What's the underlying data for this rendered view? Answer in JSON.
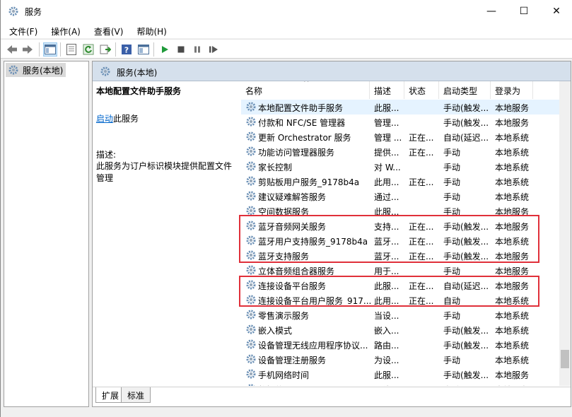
{
  "window": {
    "title": "服务",
    "minimize": "—",
    "maximize": "☐",
    "close": "✕"
  },
  "menu": [
    "文件(F)",
    "操作(A)",
    "查看(V)",
    "帮助(H)"
  ],
  "tree": {
    "item": "服务(本地)"
  },
  "pane": {
    "header": "服务(本地)",
    "selected_title": "本地配置文件助手服务",
    "start_link": "启动",
    "start_suffix": "此服务",
    "desc_label": "描述:",
    "desc_text": "此服务为订户标识模块提供配置文件管理"
  },
  "columns": [
    "名称",
    "描述",
    "状态",
    "启动类型",
    "登录为"
  ],
  "services": [
    {
      "name": "本地配置文件助手服务",
      "desc": "此服...",
      "status": "",
      "start": "手动(触发...",
      "login": "本地服务"
    },
    {
      "name": "付款和 NFC/SE 管理器",
      "desc": "管理...",
      "status": "",
      "start": "手动(触发...",
      "login": "本地服务"
    },
    {
      "name": "更新 Orchestrator 服务",
      "desc": "管理 ...",
      "status": "正在...",
      "start": "自动(延迟...",
      "login": "本地系统"
    },
    {
      "name": "功能访问管理器服务",
      "desc": "提供...",
      "status": "正在...",
      "start": "手动",
      "login": "本地系统"
    },
    {
      "name": "家长控制",
      "desc": "对 W...",
      "status": "",
      "start": "手动",
      "login": "本地系统"
    },
    {
      "name": "剪贴板用户服务_9178b4a",
      "desc": "此用...",
      "status": "正在...",
      "start": "手动",
      "login": "本地系统"
    },
    {
      "name": "建议疑难解答服务",
      "desc": "通过...",
      "status": "",
      "start": "手动",
      "login": "本地系统"
    },
    {
      "name": "空间数据服务",
      "desc": "此服...",
      "status": "",
      "start": "手动",
      "login": "本地服务"
    },
    {
      "name": "蓝牙音频网关服务",
      "desc": "支持...",
      "status": "正在...",
      "start": "手动(触发...",
      "login": "本地服务"
    },
    {
      "name": "蓝牙用户支持服务_9178b4a",
      "desc": "蓝牙...",
      "status": "正在...",
      "start": "手动(触发...",
      "login": "本地系统"
    },
    {
      "name": "蓝牙支持服务",
      "desc": "蓝牙...",
      "status": "正在...",
      "start": "手动(触发...",
      "login": "本地服务"
    },
    {
      "name": "立体音频组合器服务",
      "desc": "用于...",
      "status": "",
      "start": "手动",
      "login": "本地服务"
    },
    {
      "name": "连接设备平台服务",
      "desc": "此服...",
      "status": "正在...",
      "start": "自动(延迟...",
      "login": "本地服务"
    },
    {
      "name": "连接设备平台用户服务_917...",
      "desc": "此用...",
      "status": "正在...",
      "start": "自动",
      "login": "本地系统"
    },
    {
      "name": "零售演示服务",
      "desc": "当设...",
      "status": "",
      "start": "手动",
      "login": "本地系统"
    },
    {
      "name": "嵌入模式",
      "desc": "嵌入...",
      "status": "",
      "start": "手动(触发...",
      "login": "本地系统"
    },
    {
      "name": "设备管理无线应用程序协议...",
      "desc": "路由...",
      "status": "",
      "start": "手动(触发...",
      "login": "本地系统"
    },
    {
      "name": "设备管理注册服务",
      "desc": "为设...",
      "status": "",
      "start": "手动",
      "login": "本地系统"
    },
    {
      "name": "手机网络时间",
      "desc": "此服...",
      "status": "",
      "start": "手动(触发...",
      "login": "本地服务"
    },
    {
      "name": "数据使用量",
      "desc": "网络...",
      "status": "",
      "start": "自动",
      "login": "本地服务"
    }
  ],
  "tabs": [
    "扩展",
    "标准"
  ],
  "colors": {
    "highlight": "#e0303a",
    "header_bg": "#d5e0ec",
    "link": "#0066cc"
  }
}
